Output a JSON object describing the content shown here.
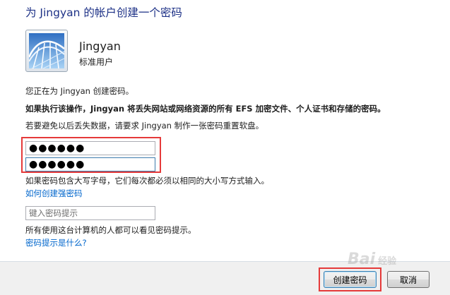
{
  "dialog": {
    "title": "为 Jingyan 的帐户创建一个密码"
  },
  "user": {
    "name": "Jingyan",
    "role": "标准用户",
    "avatar_icon": "roller-coaster-picture-icon"
  },
  "info": {
    "line1": "您正在为 Jingyan 创建密码。",
    "warning": "如果执行该操作，Jingyan 将丢失网站或网络资源的所有 EFS 加密文件、个人证书和存储的密码。",
    "line3": "若要避免以后丢失数据，请要求 Jingyan 制作一张密码重置软盘。"
  },
  "password": {
    "new_value": "●●●●●●",
    "confirm_value": "●●●●●●",
    "case_note": "如果密码包含大写字母，它们每次都必须以相同的大小写方式输入。",
    "strong_link": "如何创建强密码"
  },
  "hint": {
    "placeholder": "键入密码提示",
    "note": "所有使用这台计算机的人都可以看见密码提示。",
    "link": "密码提示是什么?"
  },
  "buttons": {
    "create": "创建密码",
    "cancel": "取消"
  },
  "watermark": {
    "text": "Bai",
    "sub": "经验"
  },
  "colors": {
    "title": "#1e3287",
    "link": "#0066cc",
    "highlight": "#e53a3a"
  }
}
